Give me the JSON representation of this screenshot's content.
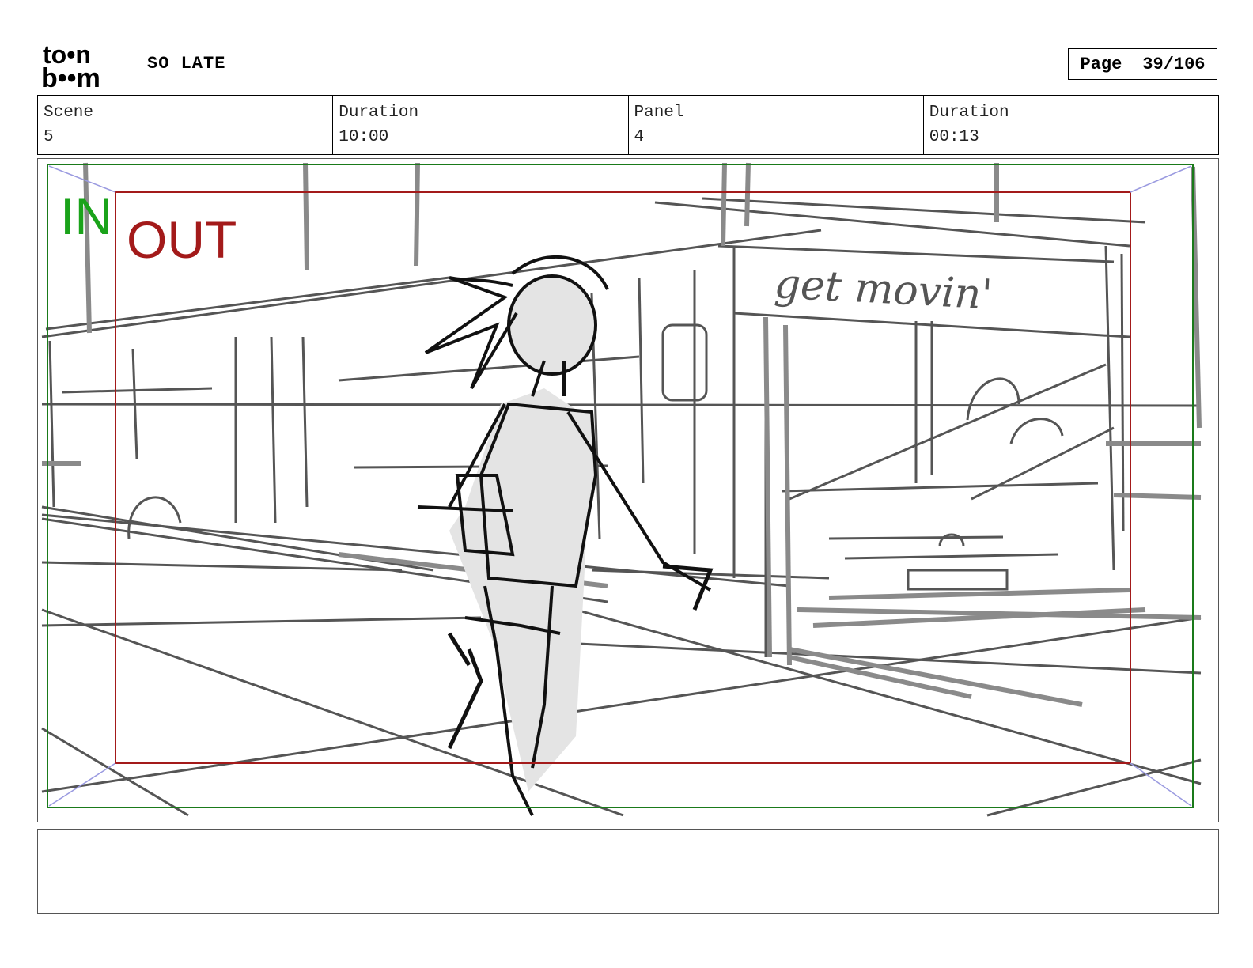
{
  "header": {
    "logo_top": "to•n",
    "logo_bottom": "b••m",
    "project_title": "SO LATE",
    "page_label": "Page",
    "page_number": "39/106"
  },
  "info": {
    "scene_label": "Scene",
    "scene_value": "5",
    "scene_duration_label": "Duration",
    "scene_duration_value": "10:00",
    "panel_label": "Panel",
    "panel_value": "4",
    "panel_duration_label": "Duration",
    "panel_duration_value": "00:13"
  },
  "panel": {
    "in_label": "IN",
    "out_label": "OUT",
    "sign_text": "get movin'",
    "in_color": "#1aa31a",
    "out_color": "#a31a1a"
  },
  "notes": {
    "text": ""
  }
}
